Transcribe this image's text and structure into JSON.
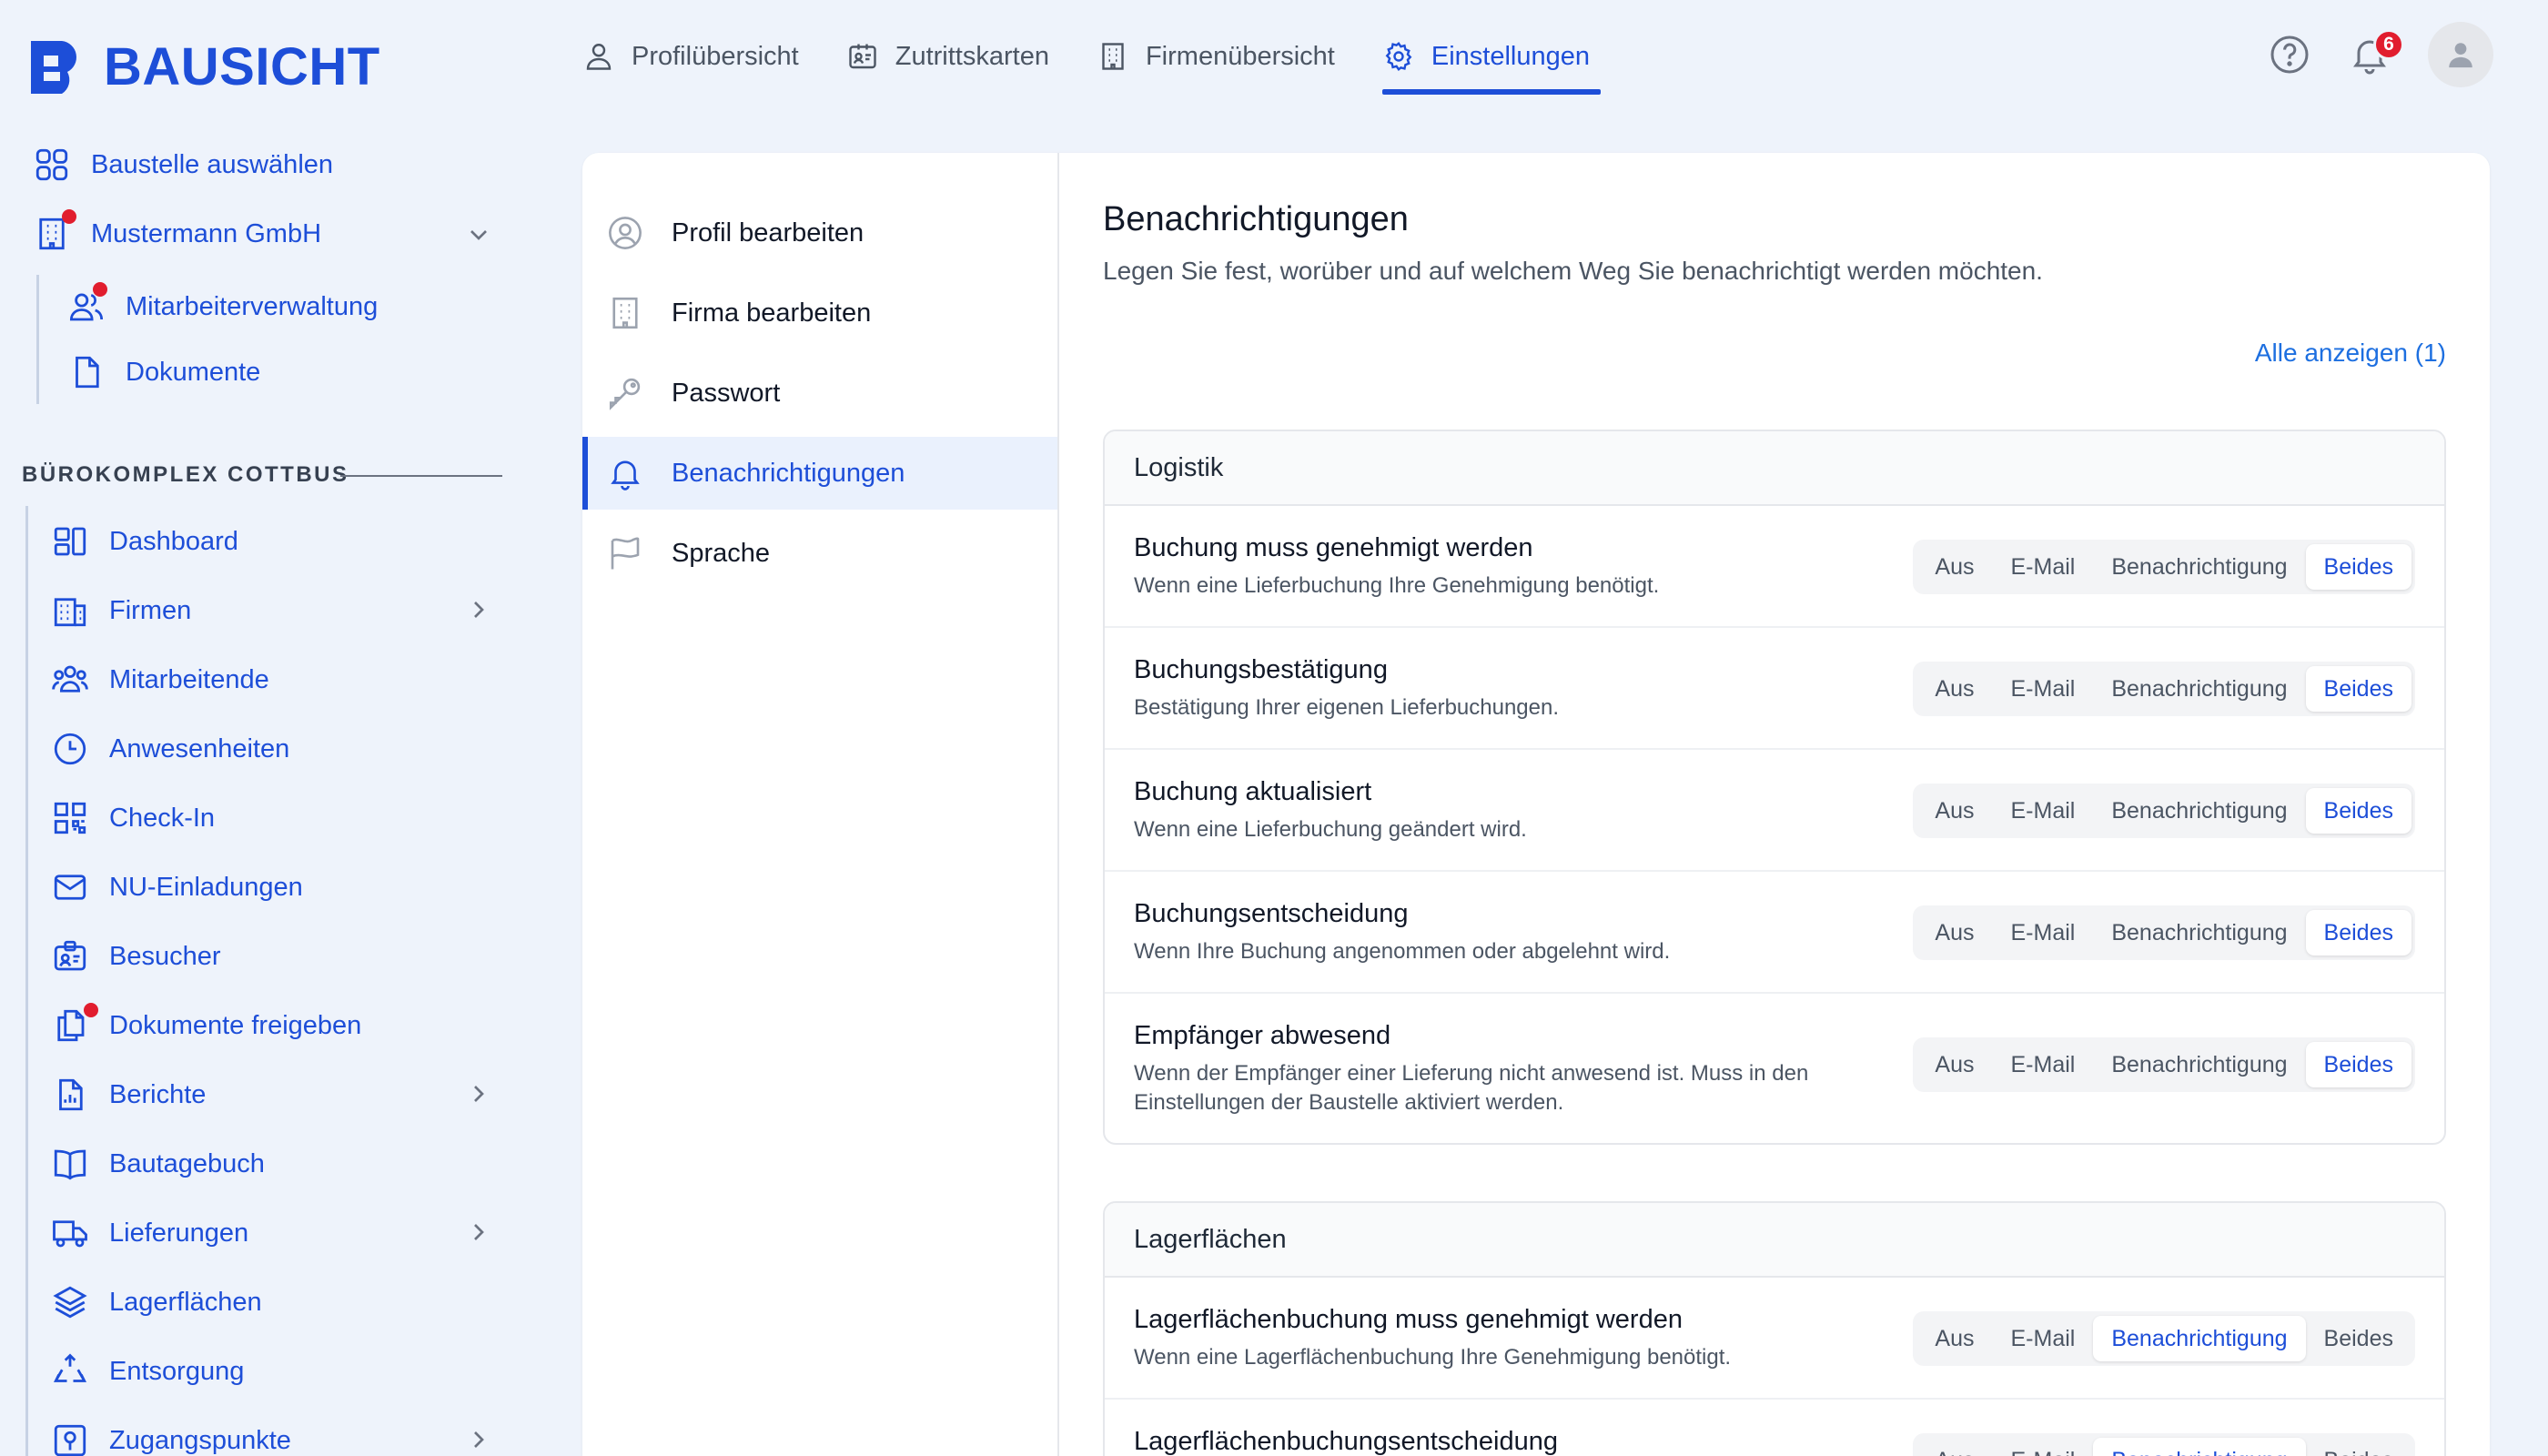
{
  "app": {
    "brand": "BAUSICHT"
  },
  "topnav": [
    {
      "label": "Profilübersicht",
      "icon": "user-icon",
      "active": false
    },
    {
      "label": "Zutrittskarten",
      "icon": "id-card-icon",
      "active": false
    },
    {
      "label": "Firmenübersicht",
      "icon": "building-icon",
      "active": false
    },
    {
      "label": "Einstellungen",
      "icon": "gear-icon",
      "active": true
    }
  ],
  "header": {
    "notification_count": "6"
  },
  "sidebar": {
    "select_site": "Baustelle auswählen",
    "company": "Mustermann GmbH",
    "company_children": [
      "Mitarbeiterverwaltung",
      "Dokumente"
    ],
    "section_title": "BÜROKOMPLEX COTTBUS",
    "items": [
      {
        "label": "Dashboard",
        "icon": "dashboard-icon",
        "chevron": false
      },
      {
        "label": "Firmen",
        "icon": "building-icon",
        "chevron": true
      },
      {
        "label": "Mitarbeitende",
        "icon": "users-icon",
        "chevron": false
      },
      {
        "label": "Anwesenheiten",
        "icon": "clock-icon",
        "chevron": false
      },
      {
        "label": "Check-In",
        "icon": "qr-code-icon",
        "chevron": false
      },
      {
        "label": "NU-Einladungen",
        "icon": "mail-icon",
        "chevron": false
      },
      {
        "label": "Besucher",
        "icon": "visitor-badge-icon",
        "chevron": false
      },
      {
        "label": "Dokumente freigeben",
        "icon": "documents-icon",
        "chevron": false
      },
      {
        "label": "Berichte",
        "icon": "report-icon",
        "chevron": true
      },
      {
        "label": "Bautagebuch",
        "icon": "book-icon",
        "chevron": false
      },
      {
        "label": "Lieferungen",
        "icon": "truck-icon",
        "chevron": true
      },
      {
        "label": "Lagerflächen",
        "icon": "layers-icon",
        "chevron": false
      },
      {
        "label": "Entsorgung",
        "icon": "recycle-icon",
        "chevron": false
      },
      {
        "label": "Zugangspunkte",
        "icon": "access-point-icon",
        "chevron": true
      }
    ]
  },
  "settings_nav": [
    {
      "label": "Profil bearbeiten",
      "icon": "user-circle-icon",
      "active": false
    },
    {
      "label": "Firma bearbeiten",
      "icon": "building-icon",
      "active": false
    },
    {
      "label": "Passwort",
      "icon": "key-icon",
      "active": false
    },
    {
      "label": "Benachrichtigungen",
      "icon": "bell-icon",
      "active": true
    },
    {
      "label": "Sprache",
      "icon": "flag-icon",
      "active": false
    }
  ],
  "content": {
    "title": "Benachrichtigungen",
    "description": "Legen Sie fest, worüber und auf welchem Weg Sie benachrichtigt werden möchten.",
    "show_all": "Alle anzeigen (1)",
    "options": [
      "Aus",
      "E-Mail",
      "Benachrichtigung",
      "Beides"
    ],
    "groups": [
      {
        "title": "Logistik",
        "rows": [
          {
            "title": "Buchung muss genehmigt werden",
            "desc": "Wenn eine Lieferbuchung Ihre Genehmigung benötigt.",
            "selected": "Beides"
          },
          {
            "title": "Buchungsbestätigung",
            "desc": "Bestätigung Ihrer eigenen Lieferbuchungen.",
            "selected": "Beides"
          },
          {
            "title": "Buchung aktualisiert",
            "desc": "Wenn eine Lieferbuchung geändert wird.",
            "selected": "Beides"
          },
          {
            "title": "Buchungsentscheidung",
            "desc": "Wenn Ihre Buchung angenommen oder abgelehnt wird.",
            "selected": "Beides"
          },
          {
            "title": "Empfänger abwesend",
            "desc": "Wenn der Empfänger einer Lieferung nicht anwesend ist. Muss in den Einstellungen der Baustelle aktiviert werden.",
            "selected": "Beides"
          }
        ]
      },
      {
        "title": "Lagerflächen",
        "rows": [
          {
            "title": "Lagerflächenbuchung muss genehmigt werden",
            "desc": "Wenn eine Lagerflächenbuchung Ihre Genehmigung benötigt.",
            "selected": "Benachrichtigung"
          },
          {
            "title": "Lagerflächenbuchungsentscheidung",
            "desc": "",
            "selected": "Benachrichtigung"
          }
        ]
      }
    ]
  },
  "colors": {
    "accent": "#1d4ed8",
    "background": "#eef3fb",
    "badge": "#e11d2e"
  }
}
